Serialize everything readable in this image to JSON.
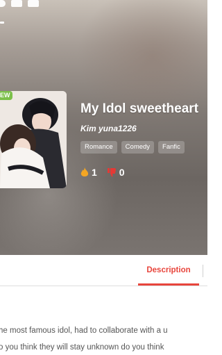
{
  "header": {
    "icons": [
      "back-icon",
      "image-icon",
      "video-icon"
    ]
  },
  "book": {
    "badge": "EW",
    "title": "My Idol sweetheart",
    "author": "Kim yuna1226",
    "tags": [
      "Romance",
      "Comedy",
      "Fanfic"
    ],
    "likes": "1",
    "dislikes": "0"
  },
  "tabs": {
    "description_label": "Description"
  },
  "description": {
    "line1": "he most famous idol, had to collaborate with a u",
    "line2": "o you think they will stay unknown do you think"
  },
  "colors": {
    "accent": "#e8453c",
    "badge": "#7cc04a",
    "fire": "#f4a623",
    "thumb": "#e53935"
  }
}
